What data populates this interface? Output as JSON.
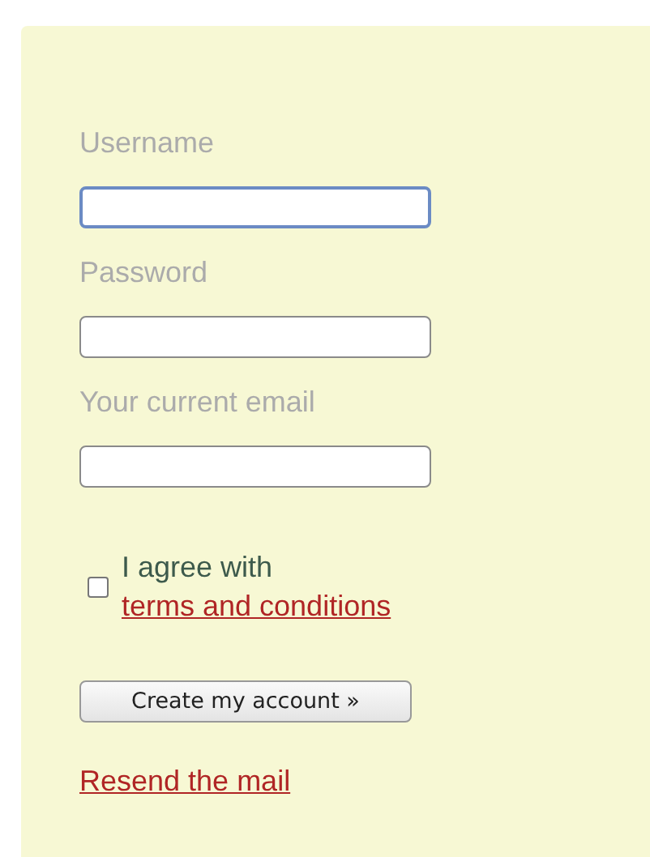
{
  "fields": [
    {
      "label": "Username",
      "focused": true
    },
    {
      "label": "Password",
      "focused": false
    },
    {
      "label": "Your current email",
      "focused": false
    }
  ],
  "agreement": {
    "checked": false,
    "text": "I agree with",
    "link": "terms and conditions"
  },
  "submit": "Create my account »",
  "resend_link": "Resend the mail"
}
